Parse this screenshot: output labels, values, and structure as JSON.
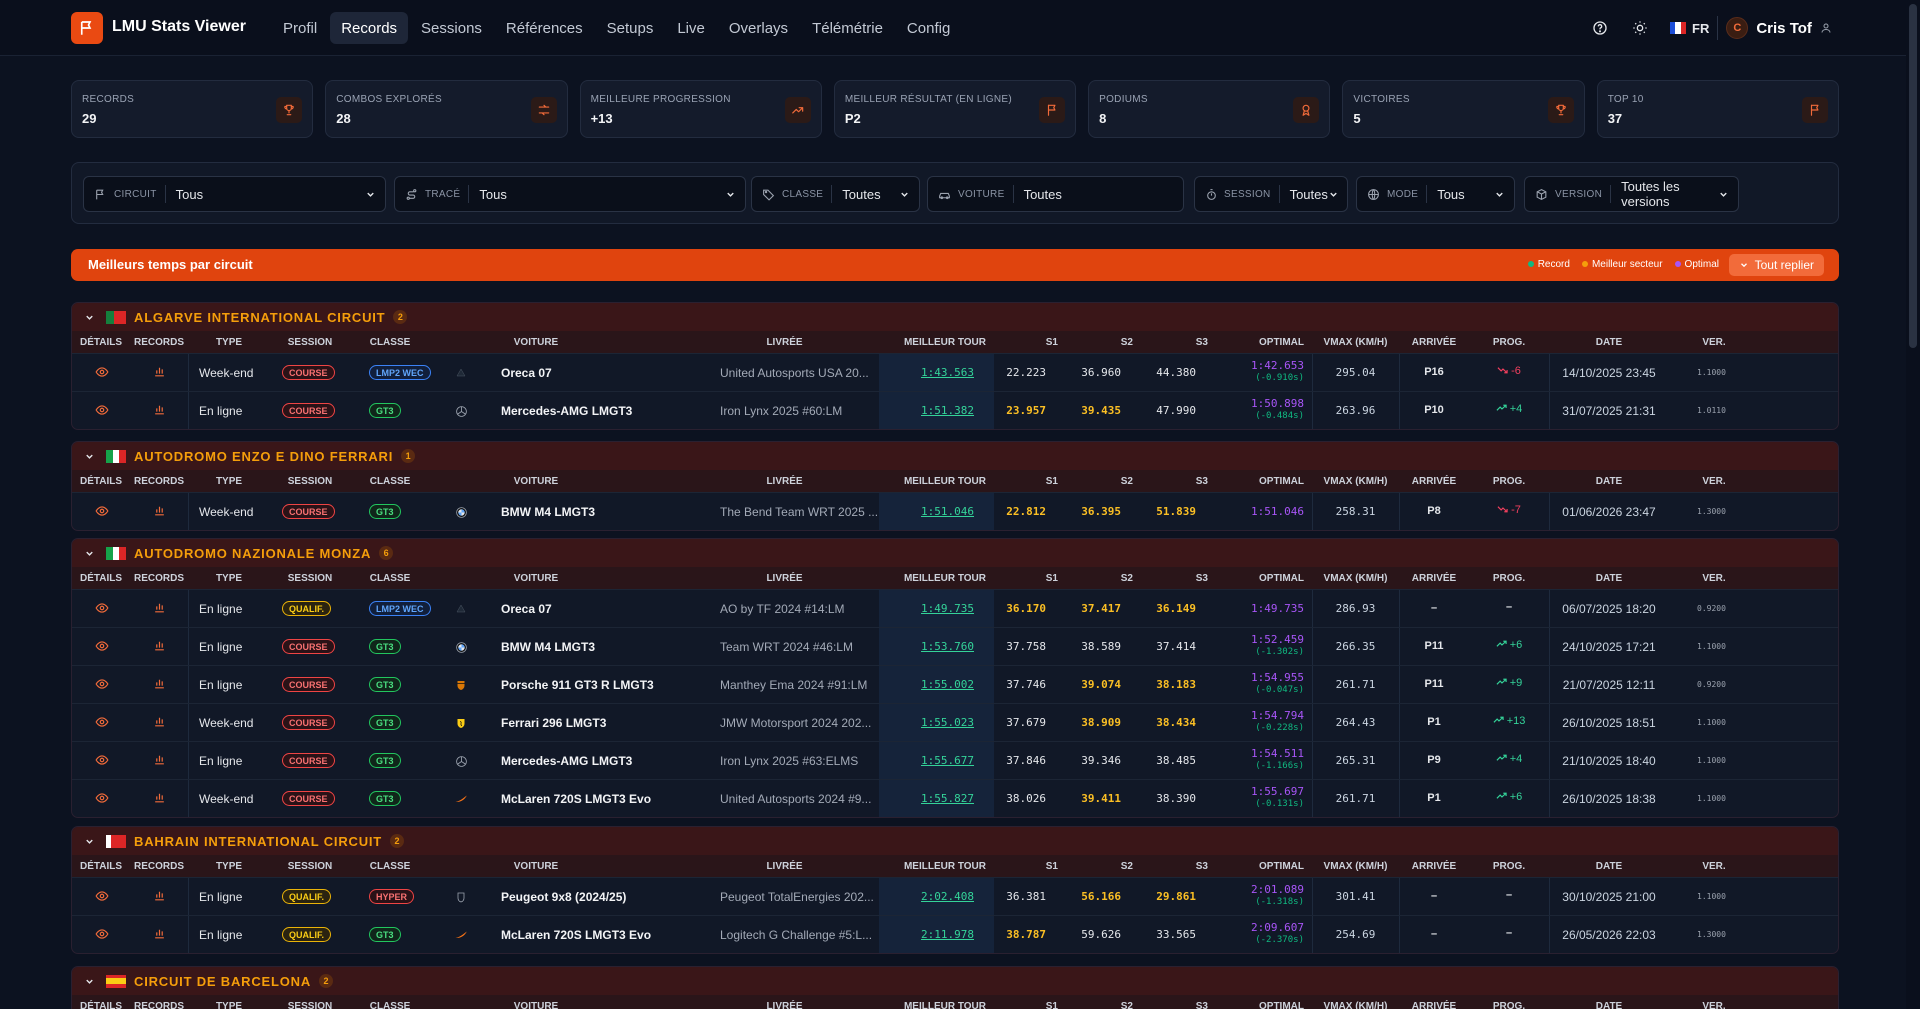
{
  "app": {
    "title": "LMU Stats Viewer"
  },
  "nav": [
    "Profil",
    "Records",
    "Sessions",
    "Références",
    "Setups",
    "Live",
    "Overlays",
    "Télémétrie",
    "Config"
  ],
  "header": {
    "lang": "FR",
    "user": "Cris Tof",
    "avatar_initial": "C"
  },
  "stats": [
    {
      "label": "RECORDS",
      "value": "29",
      "icon": "trophy-icon"
    },
    {
      "label": "COMBOS EXPLORÉS",
      "value": "28",
      "icon": "shuffle-icon"
    },
    {
      "label": "MEILLEURE PROGRESSION",
      "value": "+13",
      "icon": "trend-up-icon"
    },
    {
      "label": "MEILLEUR RÉSULTAT (EN LIGNE)",
      "value": "P2",
      "icon": "flag-icon"
    },
    {
      "label": "PODIUMS",
      "value": "8",
      "icon": "medal-icon"
    },
    {
      "label": "VICTOIRES",
      "value": "5",
      "icon": "trophy-icon"
    },
    {
      "label": "TOP 10",
      "value": "37",
      "icon": "flag-icon"
    }
  ],
  "filters": {
    "circuit": {
      "label": "CIRCUIT",
      "value": "Tous"
    },
    "trace": {
      "label": "TRACÉ",
      "value": "Tous"
    },
    "classe": {
      "label": "CLASSE",
      "value": "Toutes"
    },
    "voiture": {
      "label": "VOITURE",
      "value": "Toutes"
    },
    "session": {
      "label": "SESSION",
      "value": "Toutes"
    },
    "mode": {
      "label": "MODE",
      "value": "Tous"
    },
    "version": {
      "label": "VERSION",
      "value": "Toutes les versions"
    }
  },
  "banner": {
    "title": "Meilleurs temps par circuit",
    "legend_record": "Record",
    "legend_sector": "Meilleur secteur",
    "legend_optimal": "Optimal",
    "collapse_label": "Tout replier",
    "colors": {
      "record": "#10b981",
      "sector": "#f59e0b",
      "optimal": "#a855f7"
    }
  },
  "columns": [
    "DÉTAILS",
    "RECORDS",
    "TYPE",
    "SESSION",
    "CLASSE",
    "VOITURE",
    "LIVRÉE",
    "MEILLEUR TOUR",
    "S1",
    "S2",
    "S3",
    "OPTIMAL",
    "VMAX (KM/H)",
    "ARRIVÉE",
    "PROG.",
    "DATE",
    "VER."
  ],
  "sections": [
    {
      "name": "ALGARVE INTERNATIONAL CIRCUIT",
      "count": "2",
      "flag": "pt",
      "rows": [
        {
          "type": "Week-end",
          "session": "COURSE",
          "classe": "LMP2 WEC",
          "brand": "oreca",
          "car": "Oreca 07",
          "livery": "United Autosports USA 20...",
          "best": "1:43.563",
          "s1": "22.223",
          "s2": "36.960",
          "s3": "44.380",
          "s1y": false,
          "s2y": false,
          "s3y": false,
          "opt": "1:42.653",
          "optd": "(-0.910s)",
          "vmax": "295.04",
          "arr": "P16",
          "prog": "-6",
          "dir": "down",
          "date": "14/10/2025 23:45",
          "ver": "1.1000"
        },
        {
          "type": "En ligne",
          "session": "COURSE",
          "classe": "GT3",
          "brand": "mercedes",
          "car": "Mercedes-AMG LMGT3",
          "livery": "Iron Lynx 2025 #60:LM",
          "best": "1:51.382",
          "s1": "23.957",
          "s2": "39.435",
          "s3": "47.990",
          "s1y": true,
          "s2y": true,
          "s3y": false,
          "opt": "1:50.898",
          "optd": "(-0.484s)",
          "vmax": "263.96",
          "arr": "P10",
          "prog": "+4",
          "dir": "up",
          "date": "31/07/2025 21:31",
          "ver": "1.0110"
        }
      ]
    },
    {
      "name": "AUTODROMO ENZO E DINO FERRARI",
      "count": "1",
      "flag": "it",
      "rows": [
        {
          "type": "Week-end",
          "session": "COURSE",
          "classe": "GT3",
          "brand": "bmw",
          "car": "BMW M4 LMGT3",
          "livery": "The Bend Team WRT 2025 ...",
          "best": "1:51.046",
          "s1": "22.812",
          "s2": "36.395",
          "s3": "51.839",
          "s1y": true,
          "s2y": true,
          "s3y": true,
          "opt": "1:51.046",
          "optd": "",
          "vmax": "258.31",
          "arr": "P8",
          "prog": "-7",
          "dir": "down",
          "date": "01/06/2026 23:47",
          "ver": "1.3000"
        }
      ]
    },
    {
      "name": "AUTODROMO NAZIONALE MONZA",
      "count": "6",
      "flag": "it",
      "rows": [
        {
          "type": "En ligne",
          "session": "QUALIF.",
          "classe": "LMP2 WEC",
          "brand": "oreca",
          "car": "Oreca 07",
          "livery": "AO by TF 2024 #14:LM",
          "best": "1:49.735",
          "s1": "36.170",
          "s2": "37.417",
          "s3": "36.149",
          "s1y": true,
          "s2y": true,
          "s3y": true,
          "opt": "1:49.735",
          "optd": "",
          "vmax": "286.93",
          "arr": "–",
          "prog": "–",
          "dir": "none",
          "date": "06/07/2025 18:20",
          "ver": "0.9200"
        },
        {
          "type": "En ligne",
          "session": "COURSE",
          "classe": "GT3",
          "brand": "bmw",
          "car": "BMW M4 LMGT3",
          "livery": "Team WRT 2024 #46:LM",
          "best": "1:53.760",
          "s1": "37.758",
          "s2": "38.589",
          "s3": "37.414",
          "s1y": false,
          "s2y": false,
          "s3y": false,
          "opt": "1:52.459",
          "optd": "(-1.302s)",
          "vmax": "266.35",
          "arr": "P11",
          "prog": "+6",
          "dir": "up",
          "date": "24/10/2025 17:21",
          "ver": "1.1000"
        },
        {
          "type": "En ligne",
          "session": "COURSE",
          "classe": "GT3",
          "brand": "porsche",
          "car": "Porsche 911 GT3 R LMGT3",
          "livery": "Manthey Ema 2024 #91:LM",
          "best": "1:55.002",
          "s1": "37.746",
          "s2": "39.074",
          "s3": "38.183",
          "s1y": false,
          "s2y": true,
          "s3y": true,
          "opt": "1:54.955",
          "optd": "(-0.047s)",
          "vmax": "261.71",
          "arr": "P11",
          "prog": "+9",
          "dir": "up",
          "date": "21/07/2025 12:11",
          "ver": "0.9200"
        },
        {
          "type": "Week-end",
          "session": "COURSE",
          "classe": "GT3",
          "brand": "ferrari",
          "car": "Ferrari 296 LMGT3",
          "livery": "JMW Motorsport 2024 202...",
          "best": "1:55.023",
          "s1": "37.679",
          "s2": "38.909",
          "s3": "38.434",
          "s1y": false,
          "s2y": true,
          "s3y": true,
          "opt": "1:54.794",
          "optd": "(-0.228s)",
          "vmax": "264.43",
          "arr": "P1",
          "prog": "+13",
          "dir": "up",
          "date": "26/10/2025 18:51",
          "ver": "1.1000"
        },
        {
          "type": "En ligne",
          "session": "COURSE",
          "classe": "GT3",
          "brand": "mercedes",
          "car": "Mercedes-AMG LMGT3",
          "livery": "Iron Lynx 2025 #63:ELMS",
          "best": "1:55.677",
          "s1": "37.846",
          "s2": "39.346",
          "s3": "38.485",
          "s1y": false,
          "s2y": false,
          "s3y": false,
          "opt": "1:54.511",
          "optd": "(-1.166s)",
          "vmax": "265.31",
          "arr": "P9",
          "prog": "+4",
          "dir": "up",
          "date": "21/10/2025 18:40",
          "ver": "1.1000"
        },
        {
          "type": "Week-end",
          "session": "COURSE",
          "classe": "GT3",
          "brand": "mclaren",
          "car": "McLaren 720S LMGT3 Evo",
          "livery": "United Autosports 2024 #9...",
          "best": "1:55.827",
          "s1": "38.026",
          "s2": "39.411",
          "s3": "38.390",
          "s1y": false,
          "s2y": true,
          "s3y": false,
          "opt": "1:55.697",
          "optd": "(-0.131s)",
          "vmax": "261.71",
          "arr": "P1",
          "prog": "+6",
          "dir": "up",
          "date": "26/10/2025 18:38",
          "ver": "1.1000"
        }
      ]
    },
    {
      "name": "BAHRAIN INTERNATIONAL CIRCUIT",
      "count": "2",
      "flag": "bh",
      "rows": [
        {
          "type": "En ligne",
          "session": "QUALIF.",
          "classe": "HYPER",
          "brand": "peugeot",
          "car": "Peugeot 9x8 (2024/25)",
          "livery": "Peugeot TotalEnergies 202...",
          "best": "2:02.408",
          "s1": "36.381",
          "s2": "56.166",
          "s3": "29.861",
          "s1y": false,
          "s2y": true,
          "s3y": true,
          "opt": "2:01.089",
          "optd": "(-1.318s)",
          "vmax": "301.41",
          "arr": "–",
          "prog": "–",
          "dir": "none",
          "date": "30/10/2025 21:00",
          "ver": "1.1000"
        },
        {
          "type": "En ligne",
          "session": "QUALIF.",
          "classe": "GT3",
          "brand": "mclaren",
          "car": "McLaren 720S LMGT3 Evo",
          "livery": "Logitech G Challenge #5:L...",
          "best": "2:11.978",
          "s1": "38.787",
          "s2": "59.626",
          "s3": "33.565",
          "s1y": true,
          "s2y": false,
          "s3y": false,
          "opt": "2:09.607",
          "optd": "(-2.370s)",
          "vmax": "254.69",
          "arr": "–",
          "prog": "–",
          "dir": "none",
          "date": "26/05/2026 22:03",
          "ver": "1.3000"
        }
      ]
    },
    {
      "name": "CIRCUIT DE BARCELONA",
      "count": "2",
      "flag": "es",
      "rows": []
    }
  ]
}
